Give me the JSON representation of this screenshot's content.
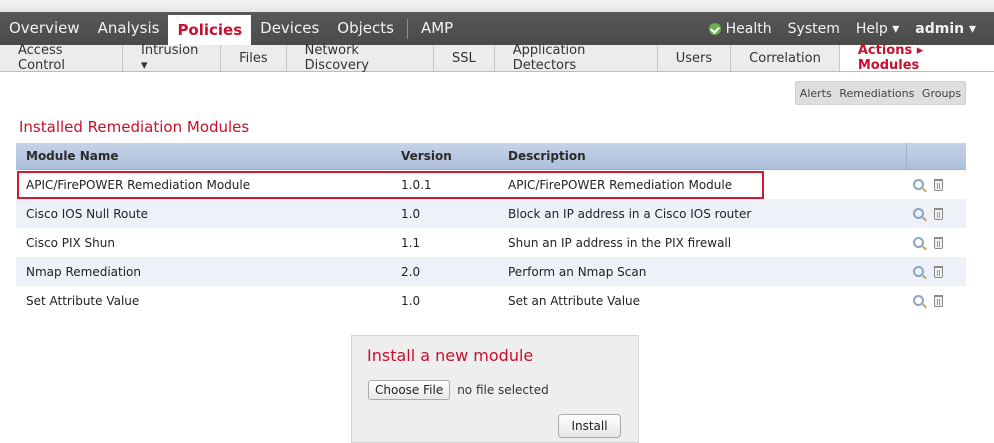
{
  "topnav": {
    "primary": [
      "Overview",
      "Analysis",
      "Policies",
      "Devices",
      "Objects",
      "AMP"
    ],
    "active": "Policies",
    "health": "Health",
    "system": "System",
    "help": "Help ▾",
    "user": "admin ▾"
  },
  "subnav": {
    "items": [
      "Access Control",
      "Intrusion ▾",
      "Files",
      "Network Discovery",
      "SSL",
      "Application Detectors",
      "Users",
      "Correlation",
      "Actions ▸ Modules"
    ],
    "active": "Actions ▸ Modules"
  },
  "buttons": {
    "alerts": "Alerts",
    "remediations": "Remediations",
    "groups": "Groups"
  },
  "heading": "Installed Remediation Modules",
  "table": {
    "headers": {
      "name": "Module Name",
      "version": "Version",
      "description": "Description"
    },
    "rows": [
      {
        "name": "APIC/FirePOWER Remediation Module",
        "version": "1.0.1",
        "description": "APIC/FirePOWER Remediation Module"
      },
      {
        "name": "Cisco IOS Null Route",
        "version": "1.0",
        "description": "Block an IP address in a Cisco IOS router"
      },
      {
        "name": "Cisco PIX Shun",
        "version": "1.1",
        "description": "Shun an IP address in the PIX firewall"
      },
      {
        "name": "Nmap Remediation",
        "version": "2.0",
        "description": "Perform an Nmap Scan"
      },
      {
        "name": "Set Attribute Value",
        "version": "1.0",
        "description": "Set an Attribute Value"
      }
    ]
  },
  "install": {
    "title": "Install a new module",
    "choose_label": "Choose File",
    "no_file": "no file selected",
    "install_label": "Install"
  },
  "colors": {
    "accent": "#c8102e",
    "header_blue": "#b8c8e2",
    "nav_bg": "#4f4f4f"
  }
}
